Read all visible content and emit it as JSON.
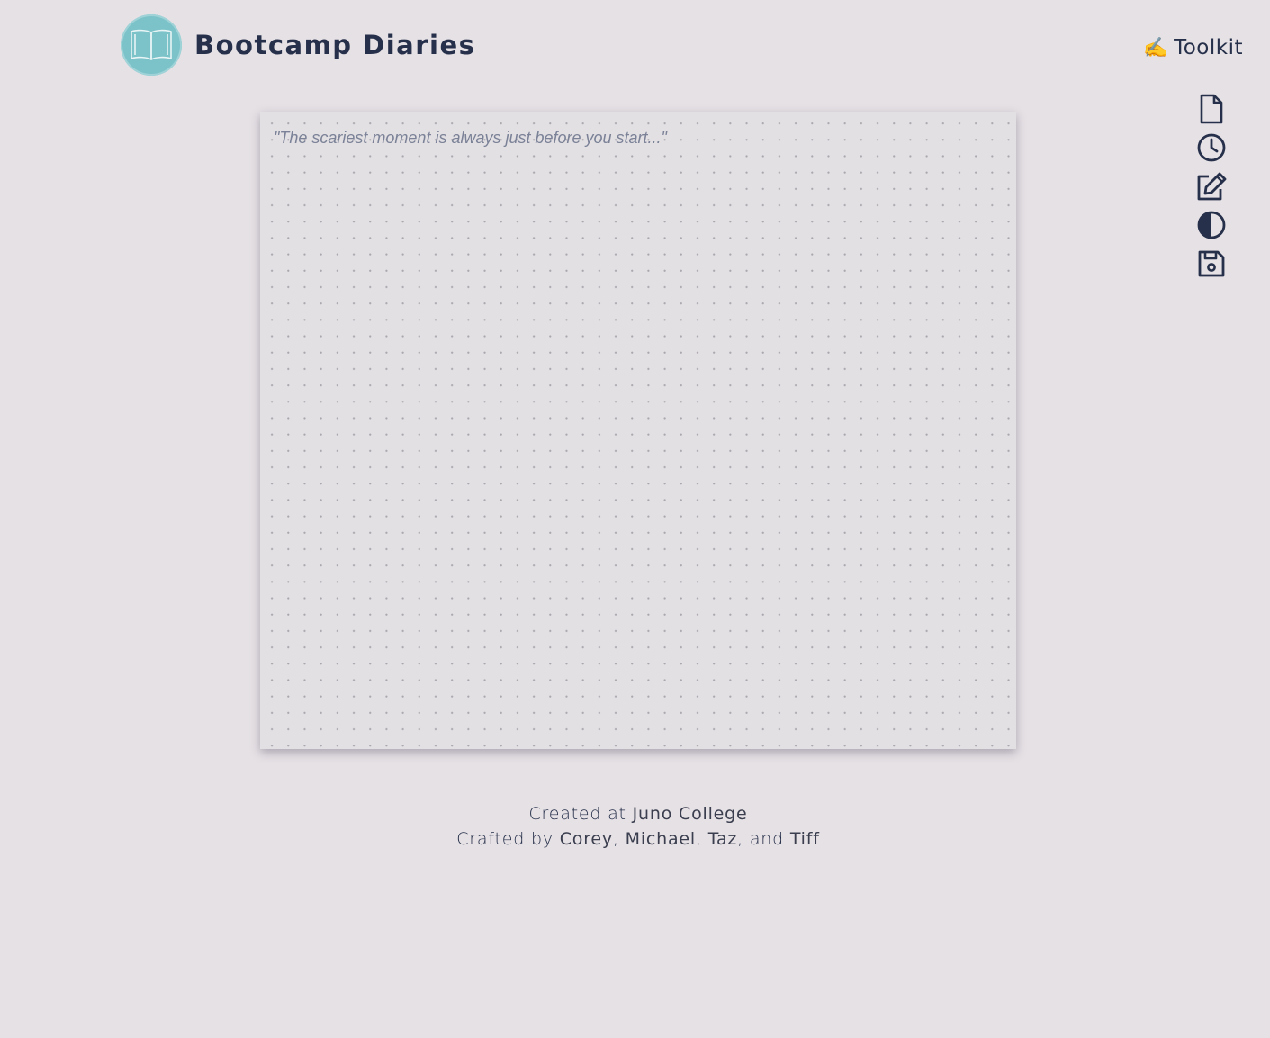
{
  "header": {
    "title": "Bootcamp Diaries",
    "logo_icon": "open-book-icon",
    "logo_color": "#7cc3c9"
  },
  "toolkit": {
    "emoji": "✍️",
    "label": "Toolkit",
    "tools": [
      {
        "name": "new-entry",
        "icon": "file-icon"
      },
      {
        "name": "history",
        "icon": "clock-icon"
      },
      {
        "name": "edit",
        "icon": "edit-icon"
      },
      {
        "name": "theme",
        "icon": "contrast-icon"
      },
      {
        "name": "save",
        "icon": "save-icon"
      }
    ]
  },
  "editor": {
    "placeholder": "\"The scariest moment is always just before you start...\"",
    "value": ""
  },
  "footer": {
    "line1_prefix": "Created at ",
    "college": "Juno College",
    "line2_prefix": "Crafted by ",
    "author1": "Corey",
    "sep1": ", ",
    "author2": "Michael",
    "sep2": ", ",
    "author3": "Taz",
    "sep3": ", and ",
    "author4": "Tiff"
  },
  "colors": {
    "background": "#e6e1e5",
    "text": "#26304a",
    "accent": "#7cc3c9"
  }
}
